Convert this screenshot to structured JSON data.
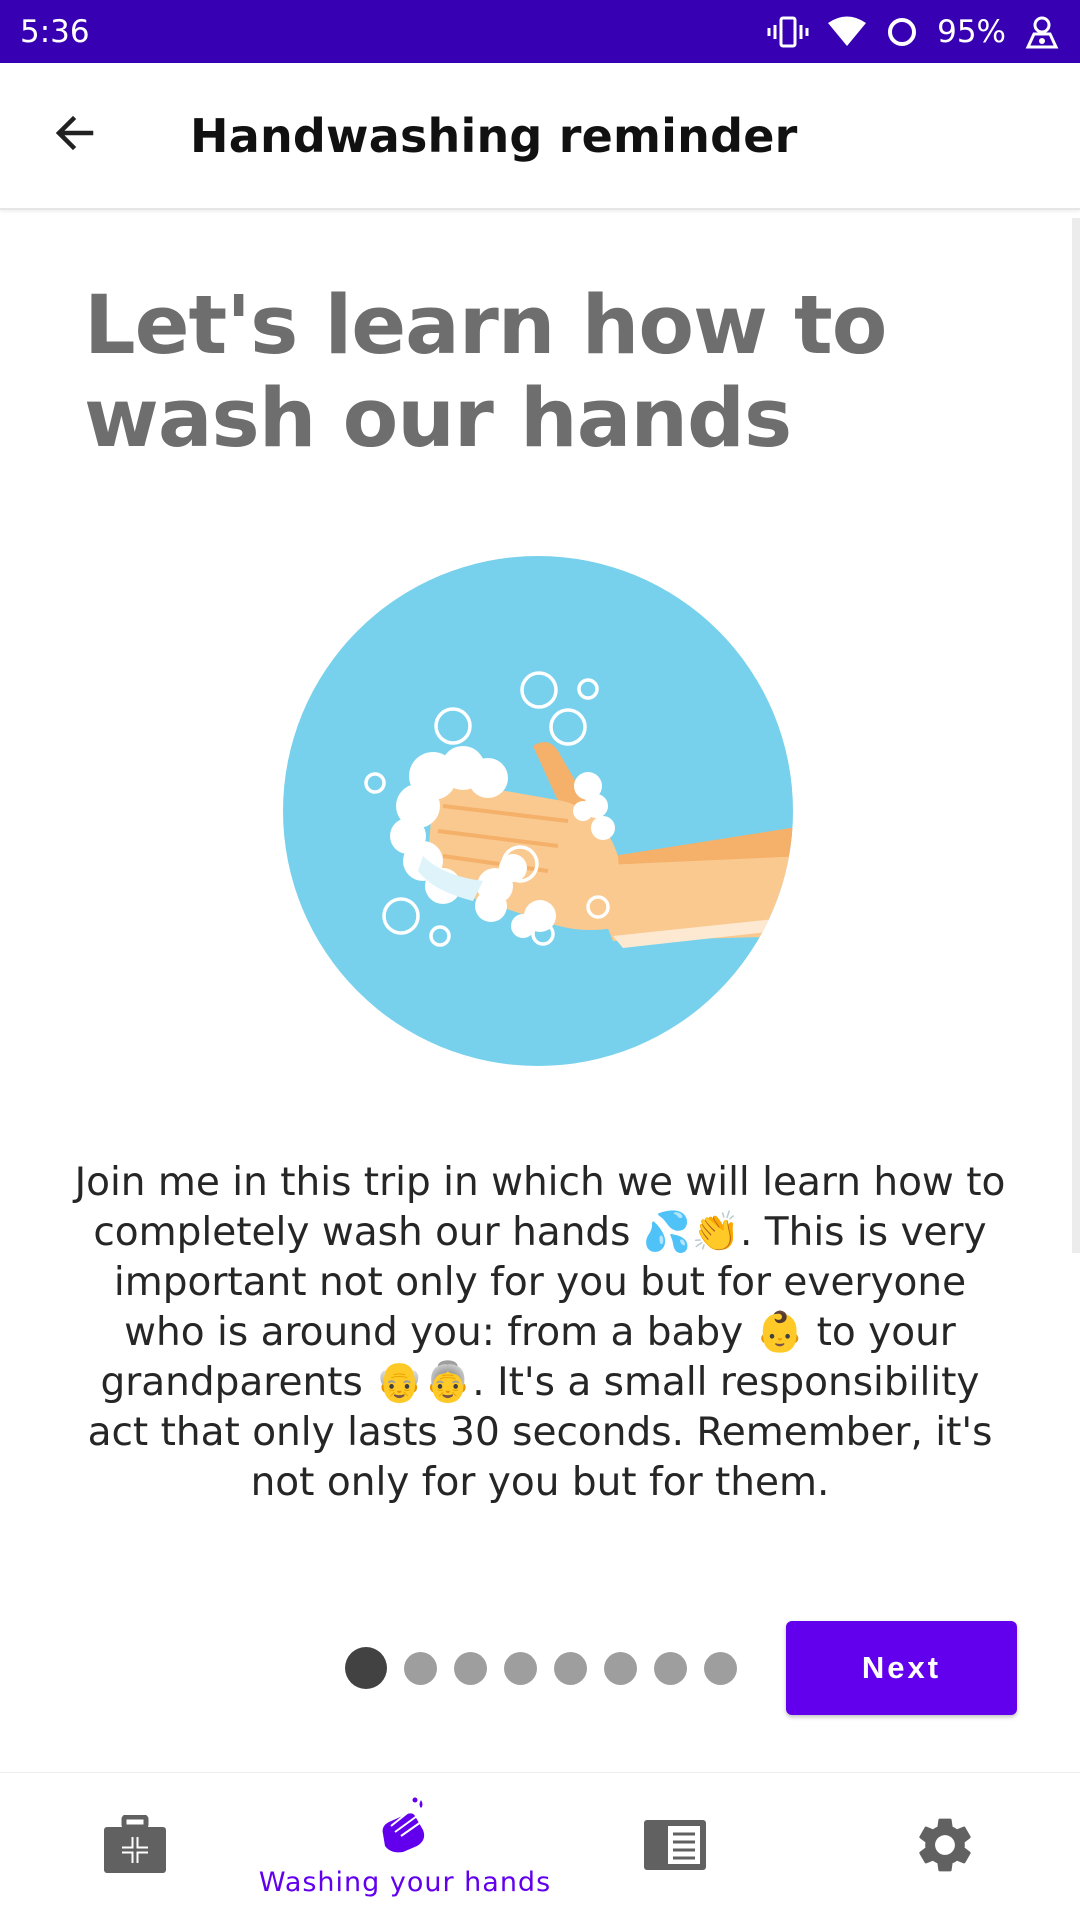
{
  "status_bar": {
    "time": "5:36",
    "battery": "95%",
    "icons": [
      "vibrate-icon",
      "wifi-icon",
      "sync-icon",
      "battery-text",
      "account-icon"
    ]
  },
  "app_bar": {
    "title": "Handwashing reminder",
    "back_icon": "arrow-back-icon"
  },
  "content": {
    "headline": "Let's learn how to wash our hands",
    "illustration_icon": "soapy-hands-illustration",
    "description": "Join me in this trip in which we will learn how to completely wash our hands 💦👏. This is very important not only for you but for everyone who is around you: from a baby 👶 to your grandparents 👴👵. It's a small responsibility act that only lasts 30 seconds. Remember, it's not only for you but for them."
  },
  "pager": {
    "total_pages": 8,
    "current_page": 1,
    "next_label": "Next"
  },
  "bottom_nav": {
    "items": [
      {
        "icon": "medical-kit-icon",
        "label": "",
        "active": false
      },
      {
        "icon": "washing-hands-icon",
        "label": "Washing your hands",
        "active": true
      },
      {
        "icon": "news-icon",
        "label": "",
        "active": false
      },
      {
        "icon": "settings-gear-icon",
        "label": "",
        "active": false
      }
    ]
  },
  "colors": {
    "status_bar": "#3700b3",
    "primary": "#6200ee",
    "illustration_bg": "#78d1ec",
    "skin_light": "#f9c98f",
    "skin_dark": "#f5b06a",
    "headline": "#6e6e6e"
  }
}
